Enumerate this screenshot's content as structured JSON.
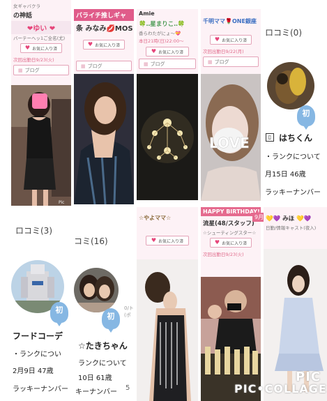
{
  "cards_top": [
    {
      "header": "女ギャバクラ",
      "title": "の神話",
      "name": "❤ゆい ❤",
      "sub": "バーテーヘッ1ご全名(尤)",
      "fav": "お気に入り済",
      "next": "次回出勤日9/23(火)",
      "blog": "ブログ"
    },
    {
      "header": "バライチ推しギャ",
      "name": "条 みなみ💋MOS",
      "sub": "",
      "fav": "お気に入り済",
      "blog": "ブログ"
    },
    {
      "header": "Amie",
      "name": "🍀‥星まりこ‥🍀",
      "sub": "香らわたがにょ〜💝",
      "fav": "お気に入り済",
      "next": "本日21時(日)22:00〜",
      "blog": "ブログ"
    },
    {
      "header": "千明ママ🌹ONE銀座",
      "name": "",
      "sub": "",
      "fav": "お気に入り済",
      "next": "次回出勤日9/22(月)",
      "blog": "ブログ",
      "photo_text": "LOVE"
    },
    {
      "kuchikomi": "ロコミ(0)",
      "badge": "初",
      "name": "はちくん",
      "rank": "・ランクについて",
      "birth": "月15日 46歳",
      "lucky": "ラッキーナンバー"
    }
  ],
  "cards_bottom": [
    {
      "kuchikomi": "ロコミ(3)",
      "badge": "初",
      "name": "フードコーデ",
      "rank": "・ランクについ",
      "birth": "2月9日 47歳",
      "lucky": "ラッキーナンバー"
    },
    {
      "kuchikomi": "コミ(16)",
      "badge": "初",
      "name": "☆たきちゃん",
      "rank": "ランクについて",
      "birth": "10日 61歳",
      "lucky": "キーナンバー",
      "extra": "5"
    },
    {
      "header": "☆やよママ☆",
      "name": "",
      "sub": "",
      "fav": "お気に入り済",
      "next": "",
      "blog": ""
    },
    {
      "header": "HAPPY BIRTHDAY!",
      "name": "流星(48/スタッフ)",
      "sub": "☆シューティングスター☆",
      "fav": "お気に入り済",
      "next": "次回出勤日9/23(火)",
      "corner": "9月"
    },
    {
      "header": "みほ",
      "name": "💛💜 みほ 💛💜",
      "sub": "日勤/情報キャスト(夜入)",
      "fav": ""
    }
  ],
  "watermark": "PIC•COLLAGE",
  "watermark2": "PIC",
  "colors": {
    "pink": "#e6457a",
    "badge_blue": "#86b7e3",
    "bg_pink": "#fdf2f6"
  }
}
